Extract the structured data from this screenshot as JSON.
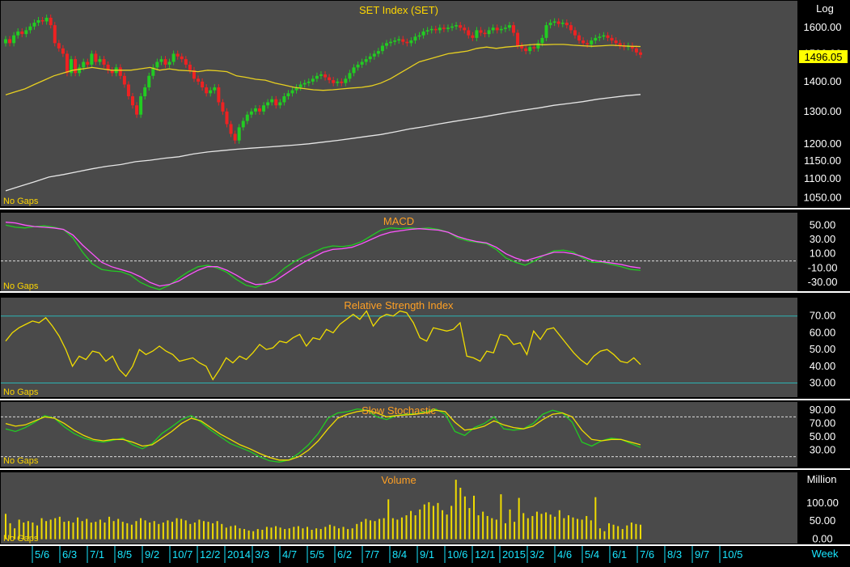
{
  "colors": {
    "panel_bg": "#4a4a4a",
    "axis_bg": "#000000",
    "separator": "#ffffff",
    "title": "#ffd700",
    "title_alt": "#ffa024",
    "axis_text": "#ffffff",
    "date_text": "#19e6ff",
    "up_candle": "#22cc22",
    "down_candle": "#ee2222",
    "ma_short": "#e8d020",
    "ma_long": "#e6e6e6",
    "macd_line": "#22cc22",
    "macd_signal": "#ff55ff",
    "rsi_line": "#f0dc00",
    "stoch_k": "#22cc22",
    "stoch_d": "#f0dc00",
    "volume_bar": "#f0dc00",
    "guide_line": "#2bb3b3",
    "price_badge_bg": "#ffff00",
    "price_badge_text": "#000000"
  },
  "chart_data": [
    {
      "type": "candlestick",
      "title": "SET Index (SET)",
      "scale_label": "Log",
      "scale": "log",
      "note": "No Gaps",
      "ylim": [
        1030,
        1700
      ],
      "yticks": [
        {
          "v": 1600,
          "label": "1600.00"
        },
        {
          "v": 1500,
          "label": "1500.00"
        },
        {
          "v": 1400,
          "label": "1400.00"
        },
        {
          "v": 1300,
          "label": "1300.00"
        },
        {
          "v": 1200,
          "label": "1200.00"
        },
        {
          "v": 1150,
          "label": "1150.00"
        },
        {
          "v": 1100,
          "label": "1100.00"
        },
        {
          "v": 1050,
          "label": "1050.00"
        }
      ],
      "last_value": 1496.05,
      "last_label": "1496.05",
      "close": [
        1555,
        1540,
        1570,
        1585,
        1575,
        1590,
        1605,
        1620,
        1630,
        1625,
        1640,
        1610,
        1540,
        1520,
        1500,
        1430,
        1480,
        1430,
        1450,
        1470,
        1460,
        1500,
        1470,
        1480,
        1460,
        1440,
        1430,
        1450,
        1420,
        1390,
        1350,
        1320,
        1290,
        1350,
        1380,
        1420,
        1450,
        1470,
        1480,
        1460,
        1470,
        1500,
        1490,
        1480,
        1460,
        1440,
        1410,
        1400,
        1380,
        1360,
        1370,
        1380,
        1330,
        1300,
        1260,
        1230,
        1210,
        1250,
        1270,
        1290,
        1300,
        1310,
        1300,
        1320,
        1330,
        1340,
        1320,
        1330,
        1350,
        1360,
        1370,
        1380,
        1390,
        1395,
        1400,
        1410,
        1420,
        1425,
        1415,
        1405,
        1395,
        1400,
        1395,
        1410,
        1430,
        1450,
        1460,
        1470,
        1480,
        1490,
        1500,
        1510,
        1530,
        1540,
        1545,
        1550,
        1555,
        1545,
        1540,
        1550,
        1565,
        1570,
        1585,
        1590,
        1595,
        1590,
        1600,
        1595,
        1600,
        1605,
        1610,
        1600,
        1590,
        1570,
        1560,
        1590,
        1580,
        1575,
        1590,
        1600,
        1590,
        1595,
        1600,
        1610,
        1580,
        1530,
        1520,
        1510,
        1525,
        1520,
        1540,
        1560,
        1610,
        1620,
        1625,
        1615,
        1620,
        1610,
        1590,
        1570,
        1550,
        1540,
        1535,
        1550,
        1560,
        1565,
        1570,
        1560,
        1550,
        1540,
        1530,
        1525,
        1530,
        1520,
        1505,
        1496
      ],
      "ma_short": [
        1355,
        1365,
        1375,
        1390,
        1405,
        1420,
        1430,
        1440,
        1445,
        1450,
        1445,
        1440,
        1440,
        1440,
        1445,
        1450,
        1440,
        1445,
        1440,
        1438,
        1435,
        1440,
        1438,
        1435,
        1420,
        1415,
        1408,
        1405,
        1395,
        1388,
        1380,
        1376,
        1372,
        1370,
        1372,
        1375,
        1378,
        1380,
        1385,
        1395,
        1410,
        1430,
        1450,
        1470,
        1480,
        1490,
        1500,
        1505,
        1510,
        1520,
        1525,
        1520,
        1525,
        1528,
        1532,
        1535,
        1534,
        1535,
        1535,
        1532,
        1530,
        1528,
        1530,
        1532,
        1530,
        1528,
        1527
      ],
      "ma_long": [
        1068,
        1080,
        1092,
        1105,
        1112,
        1120,
        1128,
        1135,
        1140,
        1148,
        1152,
        1158,
        1162,
        1170,
        1176,
        1180,
        1184,
        1187,
        1190,
        1193,
        1196,
        1200,
        1205,
        1210,
        1216,
        1222,
        1228,
        1236,
        1245,
        1252,
        1260,
        1268,
        1275,
        1282,
        1290,
        1298,
        1305,
        1312,
        1320,
        1326,
        1332,
        1340,
        1346,
        1352,
        1356
      ]
    },
    {
      "type": "line",
      "title": "MACD",
      "note": "No Gaps",
      "ylim": [
        -40,
        65
      ],
      "yticks": [
        {
          "v": 50,
          "label": "50.00"
        },
        {
          "v": 30,
          "label": "30.00"
        },
        {
          "v": 10,
          "label": "10.00"
        },
        {
          "v": -10,
          "label": "-10.00"
        },
        {
          "v": -30,
          "label": "-30.00"
        }
      ],
      "series": [
        {
          "values": [
            50,
            47,
            46,
            48,
            49,
            47,
            44,
            32,
            12,
            -4,
            -12,
            -14,
            -15,
            -20,
            -30,
            -36,
            -40,
            -34,
            -24,
            -15,
            -8,
            -6,
            -10,
            -16,
            -26,
            -34,
            -37,
            -31,
            -22,
            -10,
            -1,
            6,
            12,
            18,
            21,
            20,
            22,
            27,
            35,
            43,
            46,
            45,
            46,
            45,
            46,
            44,
            40,
            32,
            28,
            26,
            24,
            16,
            4,
            -2,
            -6,
            0,
            8,
            14,
            15,
            12,
            4,
            -2,
            -2,
            -5,
            -8,
            -12,
            -13
          ]
        },
        {
          "values": [
            54,
            53,
            50,
            48,
            47,
            46,
            44,
            36,
            22,
            10,
            -2,
            -8,
            -12,
            -16,
            -22,
            -30,
            -35,
            -33,
            -28,
            -20,
            -13,
            -8,
            -8,
            -13,
            -20,
            -28,
            -33,
            -32,
            -28,
            -19,
            -10,
            -2,
            5,
            12,
            16,
            17,
            19,
            24,
            30,
            36,
            40,
            42,
            44,
            45,
            44,
            43,
            40,
            34,
            30,
            27,
            25,
            19,
            10,
            4,
            0,
            4,
            8,
            12,
            12,
            10,
            6,
            1,
            -1,
            -3,
            -5,
            -8,
            -10
          ]
        }
      ]
    },
    {
      "type": "line",
      "title": "Relative Strength Index",
      "note": "No Gaps",
      "ylim": [
        22,
        80
      ],
      "yticks": [
        {
          "v": 70,
          "label": "70.00"
        },
        {
          "v": 60,
          "label": "60.00"
        },
        {
          "v": 50,
          "label": "50.00"
        },
        {
          "v": 40,
          "label": "40.00"
        },
        {
          "v": 30,
          "label": "30.00"
        }
      ],
      "guides": [
        70,
        30
      ],
      "series": [
        {
          "values": [
            55,
            60,
            63,
            65,
            67,
            66,
            69,
            64,
            58,
            50,
            40,
            46,
            44,
            49,
            48,
            43,
            46,
            38,
            34,
            40,
            50,
            47,
            49,
            52,
            49,
            47,
            43,
            44,
            45,
            42,
            40,
            32,
            38,
            45,
            42,
            46,
            44,
            48,
            53,
            50,
            51,
            55,
            54,
            57,
            59,
            52,
            57,
            56,
            62,
            60,
            65,
            68,
            71,
            68,
            73,
            64,
            69,
            71,
            70,
            73,
            72,
            66,
            57,
            55,
            63,
            62,
            61,
            62,
            66,
            46,
            45,
            43,
            49,
            48,
            59,
            58,
            53,
            54,
            47,
            61,
            56,
            62,
            63,
            58,
            53,
            48,
            44,
            41,
            46,
            49,
            50,
            47,
            43,
            42,
            45,
            41
          ]
        }
      ]
    },
    {
      "type": "line",
      "title": "Slow Stochastic",
      "note": "No Gaps",
      "ylim": [
        5,
        100
      ],
      "yticks": [
        {
          "v": 90,
          "label": "90.00"
        },
        {
          "v": 70,
          "label": "70.00"
        },
        {
          "v": 50,
          "label": "50.00"
        },
        {
          "v": 30,
          "label": "30.00"
        }
      ],
      "guides": [
        80,
        20
      ],
      "series": [
        {
          "values": [
            62,
            58,
            64,
            72,
            82,
            78,
            65,
            55,
            48,
            44,
            42,
            45,
            48,
            38,
            32,
            40,
            55,
            65,
            76,
            82,
            72,
            60,
            50,
            40,
            34,
            28,
            20,
            14,
            12,
            15,
            25,
            38,
            55,
            78,
            86,
            88,
            92,
            90,
            80,
            76,
            82,
            84,
            85,
            88,
            92,
            84,
            58,
            52,
            64,
            70,
            80,
            62,
            60,
            62,
            70,
            84,
            90,
            86,
            72,
            42,
            36,
            44,
            48,
            46,
            40,
            34
          ]
        },
        {
          "v": null,
          "values": [
            70,
            66,
            68,
            74,
            80,
            78,
            70,
            60,
            52,
            46,
            44,
            46,
            46,
            42,
            36,
            38,
            48,
            58,
            70,
            78,
            74,
            64,
            54,
            46,
            38,
            32,
            25,
            19,
            15,
            15,
            20,
            30,
            44,
            62,
            78,
            84,
            88,
            90,
            86,
            80,
            82,
            83,
            84,
            86,
            90,
            88,
            72,
            60,
            62,
            66,
            74,
            68,
            64,
            62,
            66,
            76,
            84,
            86,
            80,
            60,
            46,
            44,
            46,
            46,
            42,
            38
          ]
        }
      ]
    },
    {
      "type": "bar",
      "title": "Volume",
      "unit": "Million",
      "note": "No Gaps",
      "ylim": [
        -12,
        180
      ],
      "yticks": [
        {
          "v": 100,
          "label": "100.00"
        },
        {
          "v": 50,
          "label": "50.00"
        },
        {
          "v": 0,
          "label": "0.00"
        }
      ],
      "values": [
        70,
        44,
        30,
        54,
        46,
        50,
        46,
        38,
        58,
        50,
        54,
        58,
        62,
        48,
        50,
        46,
        60,
        50,
        56,
        46,
        48,
        54,
        46,
        62,
        50,
        56,
        48,
        44,
        40,
        50,
        58,
        52,
        46,
        50,
        42,
        46,
        52,
        48,
        58,
        56,
        52,
        42,
        46,
        54,
        50,
        48,
        44,
        50,
        42,
        32,
        36,
        38,
        30,
        28,
        24,
        22,
        28,
        26,
        34,
        32,
        36,
        32,
        28,
        30,
        34,
        36,
        30,
        34,
        26,
        30,
        28,
        34,
        40,
        36,
        30,
        34,
        28,
        30,
        42,
        48,
        56,
        52,
        50,
        56,
        58,
        110,
        58,
        54,
        60,
        66,
        78,
        66,
        82,
        96,
        102,
        92,
        100,
        80,
        68,
        92,
        164,
        142,
        118,
        86,
        120,
        66,
        76,
        64,
        58,
        54,
        124,
        44,
        82,
        48,
        114,
        72,
        58,
        64,
        76,
        70,
        74,
        68,
        62,
        80,
        58,
        66,
        60,
        56,
        54,
        64,
        52,
        116,
        30,
        22,
        44,
        40,
        36,
        28,
        38,
        46,
        42,
        40
      ]
    }
  ],
  "x_axis": {
    "label": "Week",
    "ticks": [
      "5/6",
      "6/3",
      "7/1",
      "8/5",
      "9/2",
      "10/7",
      "12/2",
      "2014",
      "3/3",
      "4/7",
      "5/5",
      "6/2",
      "7/7",
      "8/4",
      "9/1",
      "10/6",
      "12/1",
      "2015",
      "3/2",
      "4/6",
      "5/4",
      "6/1",
      "7/6",
      "8/3",
      "9/7",
      "10/5"
    ]
  }
}
